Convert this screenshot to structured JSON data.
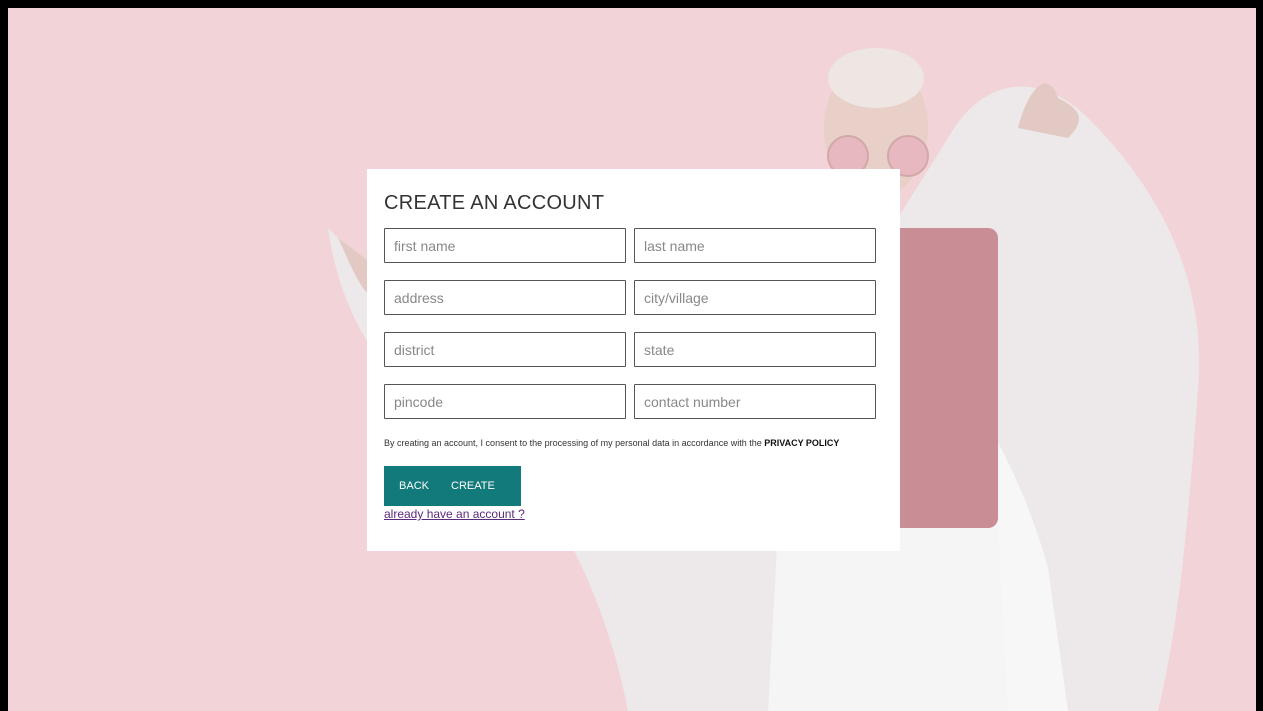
{
  "form": {
    "title": "CREATE AN ACCOUNT",
    "fields": [
      {
        "name": "first-name",
        "placeholder": "first name",
        "value": ""
      },
      {
        "name": "last-name",
        "placeholder": "last name",
        "value": ""
      },
      {
        "name": "address",
        "placeholder": "address",
        "value": ""
      },
      {
        "name": "city-village",
        "placeholder": "city/village",
        "value": ""
      },
      {
        "name": "district",
        "placeholder": "district",
        "value": ""
      },
      {
        "name": "state",
        "placeholder": "state",
        "value": ""
      },
      {
        "name": "pincode",
        "placeholder": "pincode",
        "value": ""
      },
      {
        "name": "contact-number",
        "placeholder": "contact number",
        "value": ""
      }
    ],
    "consent_text": "By creating an account, I consent to the processing of my personal data in accordance with the",
    "privacy_policy_label": "PRIVACY POLICY",
    "back_label": "BACK",
    "create_label": "CREATE",
    "login_link_label": "already have an account ?"
  },
  "colors": {
    "background_pink": "#f2d3d8",
    "button_teal": "#127a7a",
    "link_purple": "#5b2a7a"
  }
}
